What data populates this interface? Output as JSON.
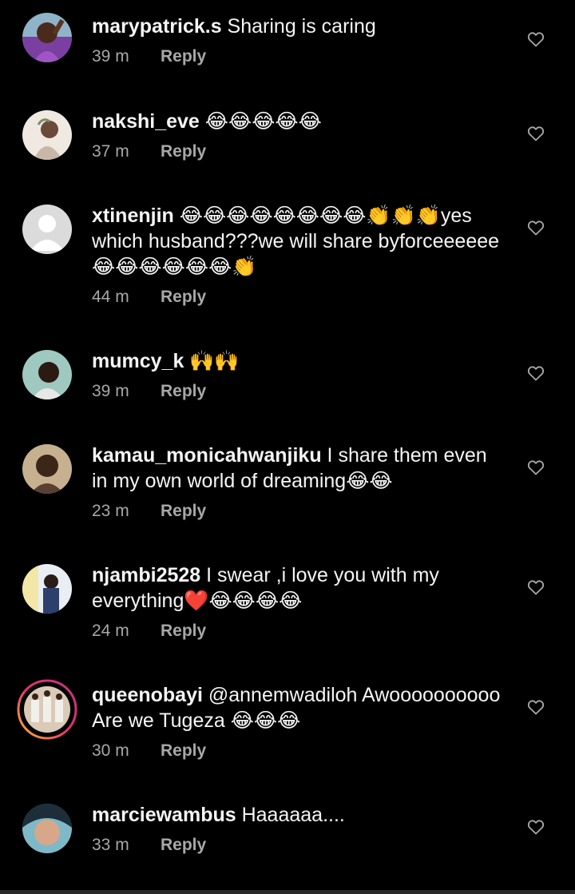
{
  "colors": {
    "background": "#000000",
    "text": "#f5f5f5",
    "secondary": "#a8a8a8"
  },
  "reply_label": "Reply",
  "comments": [
    {
      "username": "marypatrick.s",
      "text": " Sharing is caring",
      "time": "39 m",
      "avatar": "user-photo"
    },
    {
      "username": "nakshi_eve",
      "text": " 😂😂😂😂😂",
      "time": "37 m",
      "avatar": "user-photo"
    },
    {
      "username": "xtinenjin",
      "text": " 😂😂😂😂😂😂😂😂👏👏👏yes which husband???we will share byforceeeeee😂😂😂😂😂😂👏",
      "time": "44 m",
      "avatar": "default-avatar"
    },
    {
      "username": "mumcy_k",
      "text": " 🙌🙌",
      "time": "39 m",
      "avatar": "user-photo"
    },
    {
      "username": "kamau_monicahwanjiku",
      "text": " I share them even in my own world of dreaming😂😂",
      "time": "23 m",
      "avatar": "user-photo"
    },
    {
      "username": "njambi2528",
      "text": " I swear ,i love you with my everything❤️😂😂😂😂",
      "time": "24 m",
      "avatar": "user-photo"
    },
    {
      "username": "queenobayi",
      "text": " @annemwadiloh Awoooooooooo Are we Tugeza 😂😂😂",
      "time": "30 m",
      "avatar": "story-ring-photo"
    },
    {
      "username": "marciewambus",
      "text": " Haaaaaa....",
      "time": "33 m",
      "avatar": "user-photo"
    }
  ]
}
